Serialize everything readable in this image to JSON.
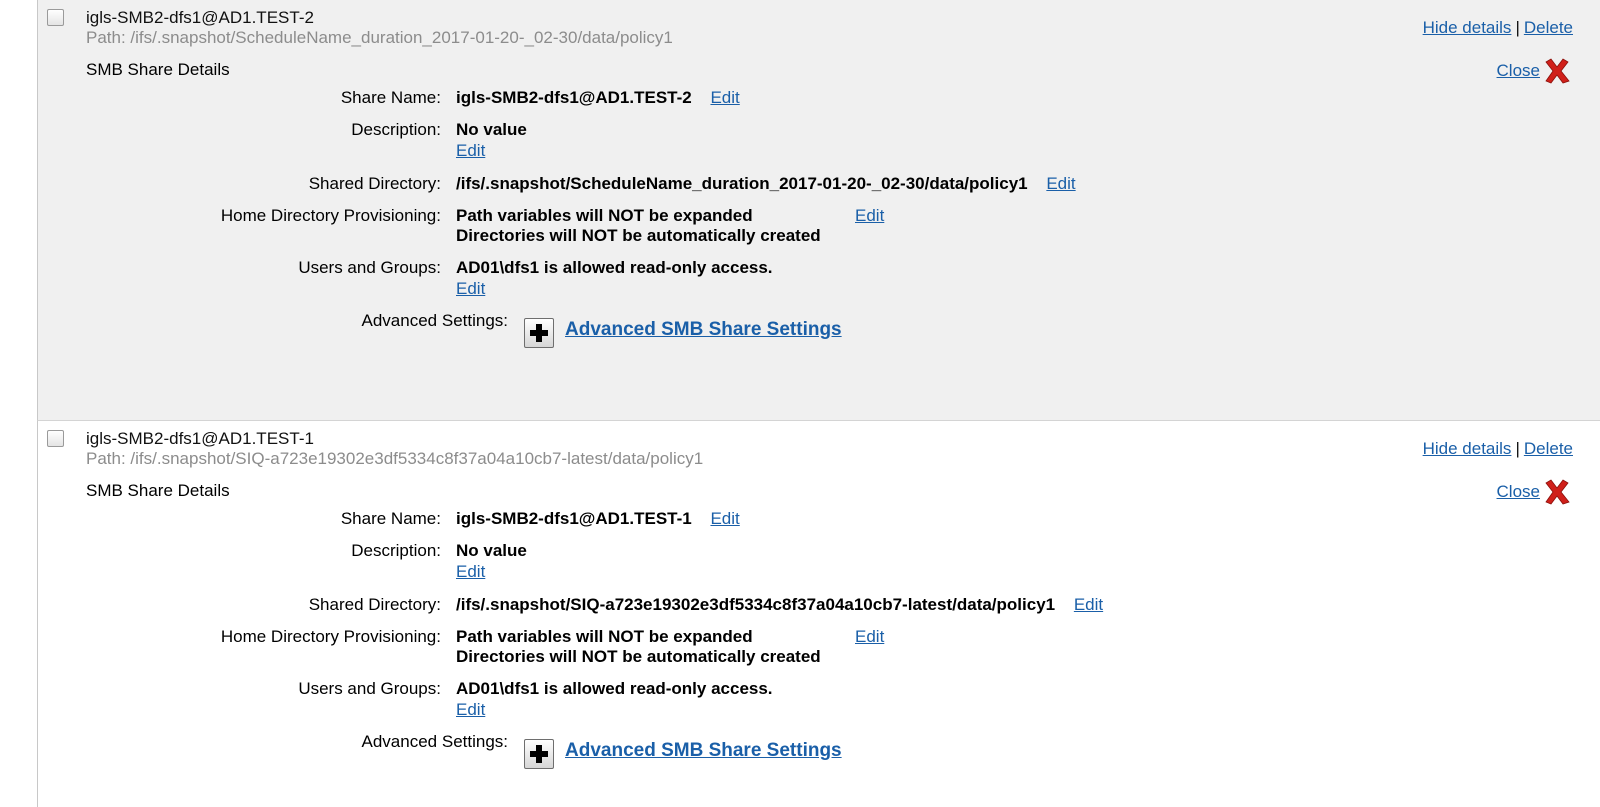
{
  "shares": [
    {
      "title": "igls-SMB2-dfs1@AD1.TEST-2",
      "path": "Path: /ifs/.snapshot/ScheduleName_duration_2017-01-20-_02-30/data/policy1",
      "hide_details": "Hide details",
      "separator": "|",
      "delete": "Delete",
      "details_heading": "SMB Share Details",
      "close": "Close",
      "share_name_label": "Share Name:",
      "share_name_value": "igls-SMB2-dfs1@AD1.TEST-2",
      "description_label": "Description:",
      "description_value": "No value",
      "shared_dir_label": "Shared Directory:",
      "shared_dir_value": "/ifs/.snapshot/ScheduleName_duration_2017-01-20-_02-30/data/policy1",
      "home_dir_label": "Home Directory Provisioning:",
      "home_dir_line1": "Path variables will NOT be expanded",
      "home_dir_line2": "Directories will NOT be automatically created",
      "users_label": "Users and Groups:",
      "users_value": "AD01\\dfs1 is allowed read-only access.",
      "advanced_label": "Advanced Settings:",
      "advanced_link": "Advanced SMB Share Settings",
      "edit": "Edit"
    },
    {
      "title": "igls-SMB2-dfs1@AD1.TEST-1",
      "path": "Path: /ifs/.snapshot/SIQ-a723e19302e3df5334c8f37a04a10cb7-latest/data/policy1",
      "hide_details": "Hide details",
      "separator": "|",
      "delete": "Delete",
      "details_heading": "SMB Share Details",
      "close": "Close",
      "share_name_label": "Share Name:",
      "share_name_value": "igls-SMB2-dfs1@AD1.TEST-1",
      "description_label": "Description:",
      "description_value": "No value",
      "shared_dir_label": "Shared Directory:",
      "shared_dir_value": "/ifs/.snapshot/SIQ-a723e19302e3df5334c8f37a04a10cb7-latest/data/policy1",
      "home_dir_label": "Home Directory Provisioning:",
      "home_dir_line1": "Path variables will NOT be expanded",
      "home_dir_line2": "Directories will NOT be automatically created",
      "users_label": "Users and Groups:",
      "users_value": "AD01\\dfs1 is allowed read-only access.",
      "advanced_label": "Advanced Settings:",
      "advanced_link": "Advanced SMB Share Settings",
      "edit": "Edit"
    }
  ],
  "icons": {
    "close": "close-x-icon",
    "expand": "plus-icon"
  },
  "colors": {
    "link": "#1a5fa8",
    "close_x": "#d0201a",
    "panel_bg": "#f0f0f0",
    "path_text": "#8c8c8c"
  }
}
